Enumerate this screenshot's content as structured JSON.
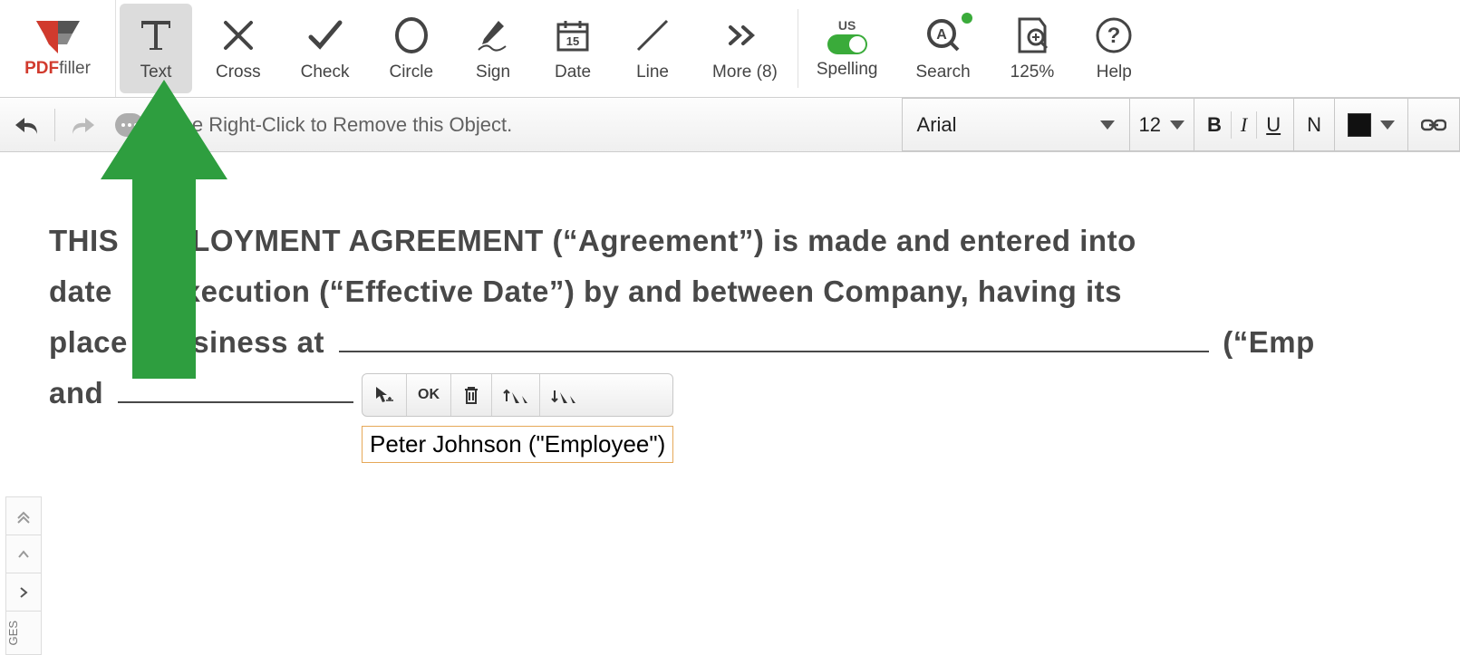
{
  "brand": {
    "name1": "PDF",
    "name2": "filler"
  },
  "toolbar": {
    "text": "Text",
    "cross": "Cross",
    "check": "Check",
    "circle": "Circle",
    "sign": "Sign",
    "date": "Date",
    "line": "Line",
    "more": "More (8)",
    "spelling_label": "Spelling",
    "spelling_lang": "US",
    "search": "Search",
    "zoom": "125%",
    "help": "Help"
  },
  "subbar": {
    "hint": "Use Right-Click to Remove this Object.",
    "font": "Arial",
    "size": "12",
    "bold": "B",
    "italic": "I",
    "underline": "U",
    "normal": "N"
  },
  "document": {
    "line1_a": "THIS",
    "line1_b": "LOYMENT AGREEMENT (“Agreement”) is made and entered into",
    "line2_a": "date",
    "line2_b": "execution (“Effective Date”) by and between Company, having its",
    "line3_a": "place",
    "line3_b": "business at ",
    "line3_c": " (“Emp",
    "line4_a": "and "
  },
  "edit": {
    "ok": "OK",
    "value": "Peter Johnson (\"Employee\")"
  },
  "rail": {
    "label": "GES"
  }
}
